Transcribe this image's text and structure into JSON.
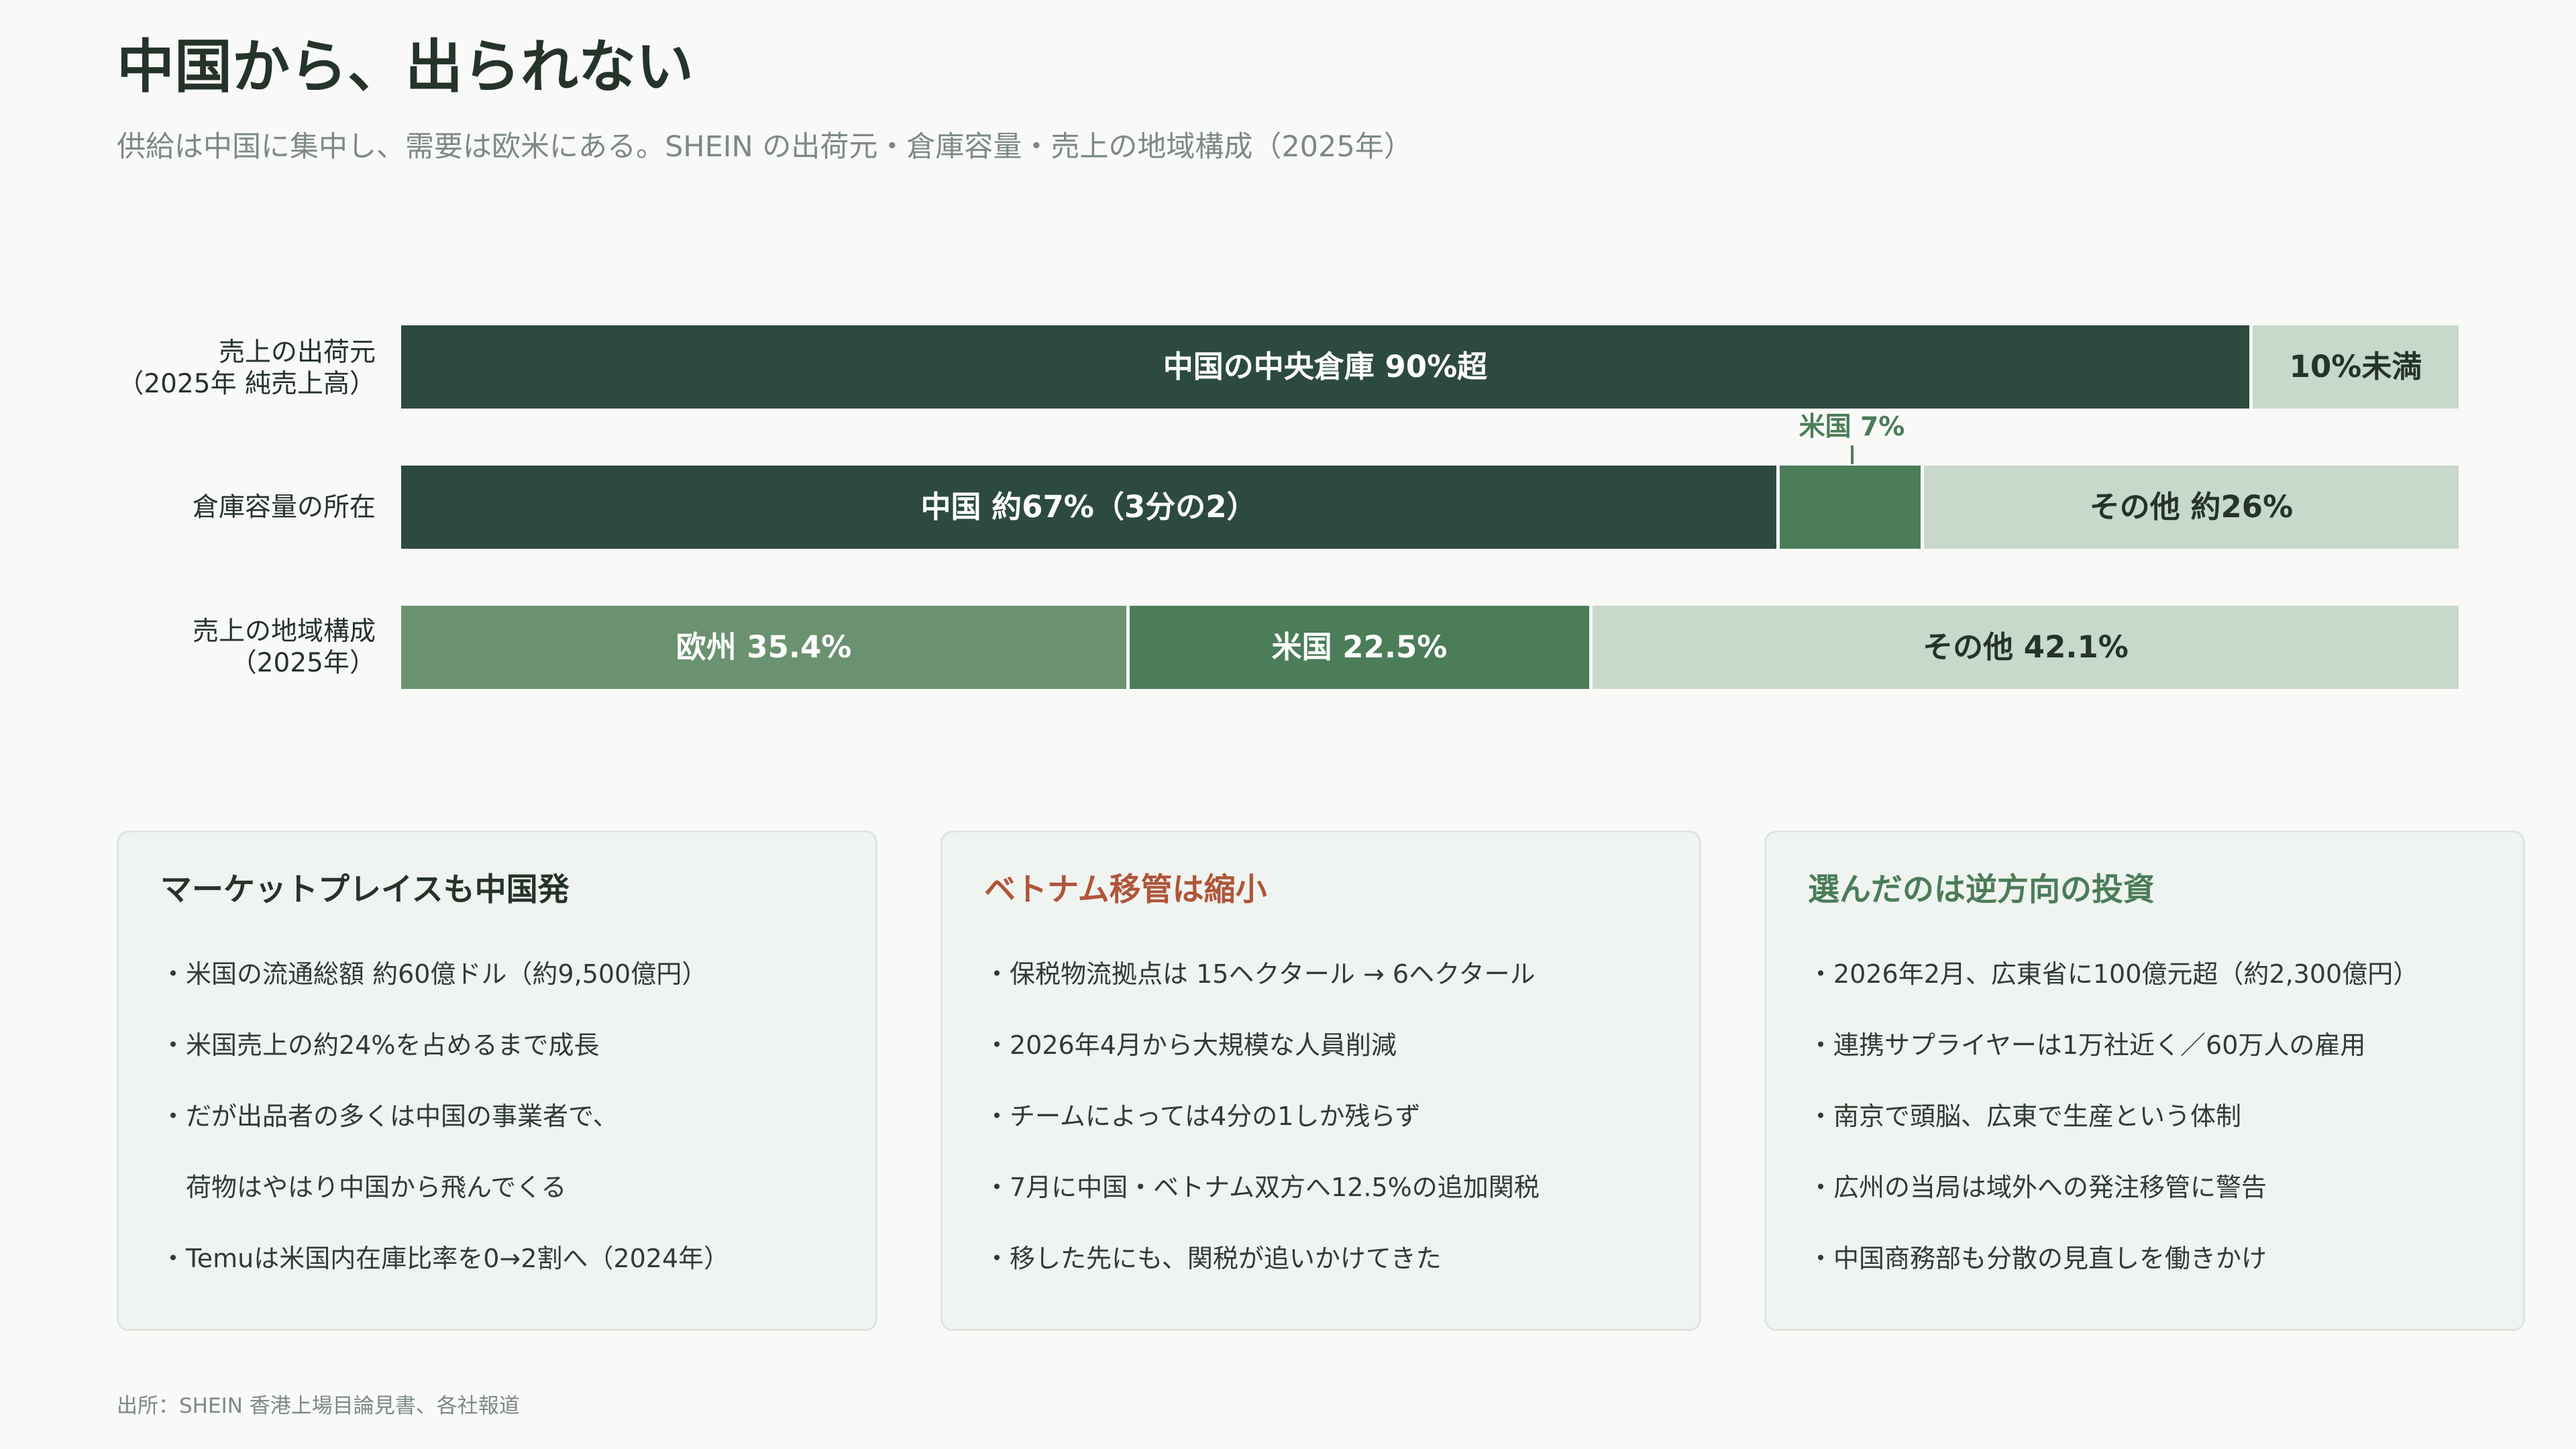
{
  "header": {
    "title": "中国から、出られない",
    "subtitle": "供給は中国に集中し、需要は欧米にある。SHEIN の出荷元・倉庫容量・売上の地域構成（2025年）"
  },
  "chart_data": {
    "type": "bar",
    "stacked": true,
    "orientation": "horizontal",
    "normalized": true,
    "unit": "%",
    "categories": [
      "売上の出荷元\n（2025年 純売上高）",
      "倉庫容量の所在",
      "売上の地域構成\n（2025年）"
    ],
    "rows": [
      {
        "category": "売上の出荷元\n（2025年 純売上高）",
        "segments": [
          {
            "label": "中国の中央倉庫 90%超",
            "value": 90,
            "color": "#2d4a3e",
            "text_color": "light"
          },
          {
            "label": "10%未満",
            "value": 10,
            "color": "#c8d9cb",
            "text_color": "dark"
          }
        ]
      },
      {
        "category": "倉庫容量の所在",
        "segments": [
          {
            "label": "中国 約67%（3分の2）",
            "value": 67,
            "color": "#2d4a3e",
            "text_color": "light"
          },
          {
            "label": "米国 7%",
            "value": 7,
            "color": "#4a7d58",
            "text_color": "light",
            "callout": true
          },
          {
            "label": "その他 約26%",
            "value": 26,
            "color": "#c8d9cb",
            "text_color": "dark"
          }
        ]
      },
      {
        "category": "売上の地域構成\n（2025年）",
        "segments": [
          {
            "label": "欧州 35.4%",
            "value": 35.4,
            "color": "#6b9270",
            "text_color": "light"
          },
          {
            "label": "米国 22.5%",
            "value": 22.5,
            "color": "#4a7d58",
            "text_color": "light"
          },
          {
            "label": "その他 42.1%",
            "value": 42.1,
            "color": "#c8d9cb",
            "text_color": "dark"
          }
        ]
      }
    ],
    "xlim": [
      0,
      100
    ],
    "grid": false,
    "legend": "none"
  },
  "cards": [
    {
      "title": "マーケットプレイスも中国発",
      "title_color": "#25332b",
      "items": [
        "・米国の流通総額 約60億ドル（約9,500億円）",
        "・米国売上の約24%を占めるまで成長",
        "・だが出品者の多くは中国の事業者で、",
        "　荷物はやはり中国から飛んでくる",
        "・Temuは米国内在庫比率を0→2割へ（2024年）"
      ]
    },
    {
      "title": "ベトナム移管は縮小",
      "title_color": "#b0553a",
      "items": [
        "・保税物流拠点は 15ヘクタール → 6ヘクタール",
        "・2026年4月から大規模な人員削減",
        "・チームによっては4分の1しか残らず",
        "・7月に中国・ベトナム双方へ12.5%の追加関税",
        "・移した先にも、関税が追いかけてきた"
      ]
    },
    {
      "title": "選んだのは逆方向の投資",
      "title_color": "#4a7d58",
      "items": [
        "・2026年2月、広東省に100億元超（約2,300億円）",
        "・連携サプライヤーは1万社近く／60万人の雇用",
        "・南京で頭脳、広東で生産という体制",
        "・広州の当局は域外への発注移管に警告",
        "・中国商務部も分散の見直しを働きかけ"
      ]
    }
  ],
  "footer": {
    "source": "出所：SHEIN 香港上場目論見書、各社報道"
  }
}
